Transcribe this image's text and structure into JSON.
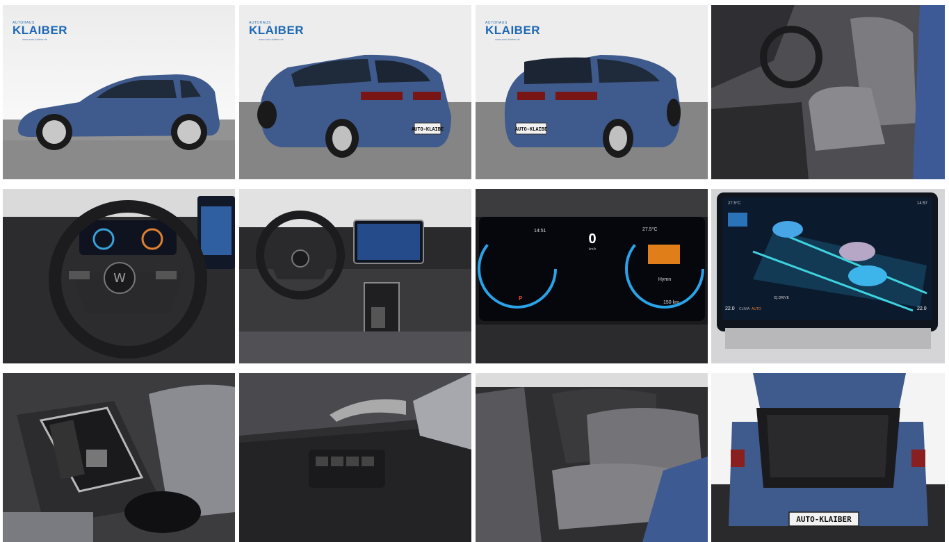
{
  "gallery": {
    "photos": [
      {
        "id": "exterior-side",
        "label": "Exterior side view"
      },
      {
        "id": "exterior-rear-left",
        "label": "Exterior rear left view"
      },
      {
        "id": "exterior-rear-right",
        "label": "Exterior rear right view"
      },
      {
        "id": "front-seats",
        "label": "Front seats"
      },
      {
        "id": "steering-wheel",
        "label": "Steering wheel"
      },
      {
        "id": "dashboard",
        "label": "Dashboard"
      },
      {
        "id": "instrument-cluster",
        "label": "Instrument cluster"
      },
      {
        "id": "infotainment",
        "label": "Infotainment screen"
      },
      {
        "id": "gear-selector",
        "label": "Gear selector"
      },
      {
        "id": "door-panel",
        "label": "Door panel"
      },
      {
        "id": "rear-seats",
        "label": "Rear seats"
      },
      {
        "id": "trunk",
        "label": "Open trunk"
      }
    ]
  },
  "dealer": {
    "logo_top": "AUTOHAUS",
    "logo_name": "KLAIBER",
    "logo_url": "www.auto-klaiber.de"
  },
  "plates": {
    "rear_plate": "AUTO-KLAIBER",
    "rear_plate_small": "AUTO-KLAIBE"
  },
  "cluster": {
    "time": "14:51",
    "temp": "27.5°C",
    "speed": "0",
    "speed_unit": "km/h",
    "range": "150 km",
    "mode": "Hymn",
    "gear": "P"
  },
  "infotainment": {
    "temp_left": "22.0",
    "temp_right": "22.0",
    "temp_status": "27.5°C",
    "clock": "14:57",
    "label": "IQ.DRIVE",
    "climate": "CLIMA",
    "auto": "AUTO"
  },
  "colors": {
    "car_blue": "#3f5a8c",
    "background": "#ffffff"
  }
}
